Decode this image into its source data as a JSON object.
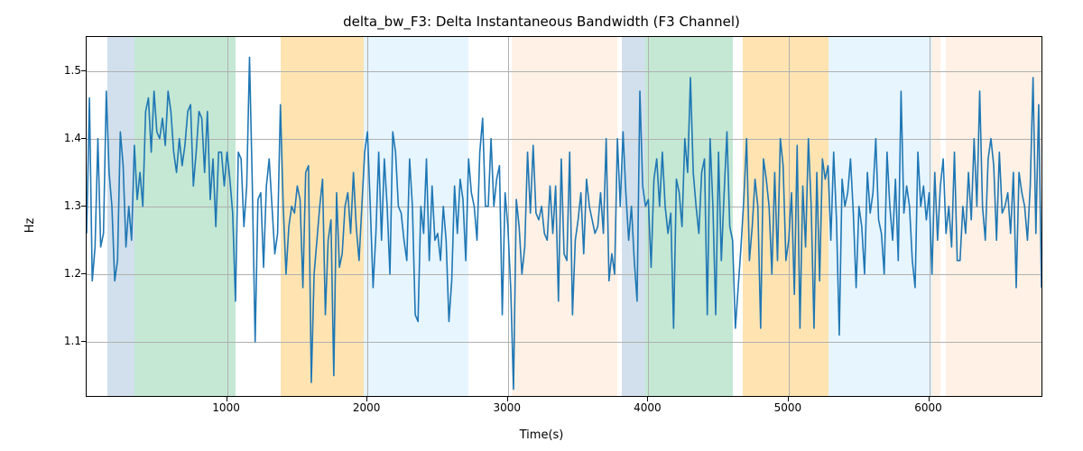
{
  "chart_data": {
    "type": "line",
    "title": "delta_bw_F3: Delta Instantaneous Bandwidth (F3 Channel)",
    "xlabel": "Time(s)",
    "ylabel": "Hz",
    "xlim": [
      0,
      6800
    ],
    "ylim": [
      1.02,
      1.55
    ],
    "xticks": [
      1000,
      2000,
      3000,
      4000,
      5000,
      6000
    ],
    "yticks": [
      1.1,
      1.2,
      1.3,
      1.4,
      1.5
    ],
    "bands": [
      {
        "x0": 150,
        "x1": 340,
        "color": "blue"
      },
      {
        "x0": 340,
        "x1": 1060,
        "color": "green"
      },
      {
        "x0": 1380,
        "x1": 1970,
        "color": "orange"
      },
      {
        "x0": 1970,
        "x1": 2720,
        "color": "lblue"
      },
      {
        "x0": 3030,
        "x1": 3780,
        "color": "peach"
      },
      {
        "x0": 3810,
        "x1": 3980,
        "color": "blue"
      },
      {
        "x0": 3980,
        "x1": 4600,
        "color": "green"
      },
      {
        "x0": 4670,
        "x1": 5280,
        "color": "orange"
      },
      {
        "x0": 5280,
        "x1": 6020,
        "color": "lblue"
      },
      {
        "x0": 6020,
        "x1": 6080,
        "color": "peach"
      },
      {
        "x0": 6120,
        "x1": 6800,
        "color": "peach"
      }
    ],
    "x": [
      0,
      20,
      40,
      60,
      80,
      100,
      120,
      140,
      160,
      180,
      200,
      220,
      240,
      260,
      280,
      300,
      320,
      340,
      360,
      380,
      400,
      420,
      440,
      460,
      480,
      500,
      520,
      540,
      560,
      580,
      600,
      620,
      640,
      660,
      680,
      700,
      720,
      740,
      760,
      780,
      800,
      820,
      840,
      860,
      880,
      900,
      920,
      940,
      960,
      980,
      1000,
      1020,
      1040,
      1060,
      1080,
      1100,
      1120,
      1140,
      1160,
      1180,
      1200,
      1220,
      1240,
      1260,
      1280,
      1300,
      1320,
      1340,
      1360,
      1380,
      1400,
      1420,
      1440,
      1460,
      1480,
      1500,
      1520,
      1540,
      1560,
      1580,
      1600,
      1620,
      1640,
      1660,
      1680,
      1700,
      1720,
      1740,
      1760,
      1780,
      1800,
      1820,
      1840,
      1860,
      1880,
      1900,
      1920,
      1940,
      1960,
      1980,
      2000,
      2020,
      2040,
      2060,
      2080,
      2100,
      2120,
      2140,
      2160,
      2180,
      2200,
      2220,
      2240,
      2260,
      2280,
      2300,
      2320,
      2340,
      2360,
      2380,
      2400,
      2420,
      2440,
      2460,
      2480,
      2500,
      2520,
      2540,
      2560,
      2580,
      2600,
      2620,
      2640,
      2660,
      2680,
      2700,
      2720,
      2740,
      2760,
      2780,
      2800,
      2820,
      2840,
      2860,
      2880,
      2900,
      2920,
      2940,
      2960,
      2980,
      3000,
      3020,
      3040,
      3060,
      3080,
      3100,
      3120,
      3140,
      3160,
      3180,
      3200,
      3220,
      3240,
      3260,
      3280,
      3300,
      3320,
      3340,
      3360,
      3380,
      3400,
      3420,
      3440,
      3460,
      3480,
      3500,
      3520,
      3540,
      3560,
      3580,
      3600,
      3620,
      3640,
      3660,
      3680,
      3700,
      3720,
      3740,
      3760,
      3780,
      3800,
      3820,
      3840,
      3860,
      3880,
      3900,
      3920,
      3940,
      3960,
      3980,
      4000,
      4020,
      4040,
      4060,
      4080,
      4100,
      4120,
      4140,
      4160,
      4180,
      4200,
      4220,
      4240,
      4260,
      4280,
      4300,
      4320,
      4340,
      4360,
      4380,
      4400,
      4420,
      4440,
      4460,
      4480,
      4500,
      4520,
      4540,
      4560,
      4580,
      4600,
      4620,
      4640,
      4660,
      4680,
      4700,
      4720,
      4740,
      4760,
      4780,
      4800,
      4820,
      4840,
      4860,
      4880,
      4900,
      4920,
      4940,
      4960,
      4980,
      5000,
      5020,
      5040,
      5060,
      5080,
      5100,
      5120,
      5140,
      5160,
      5180,
      5200,
      5220,
      5240,
      5260,
      5280,
      5300,
      5320,
      5340,
      5360,
      5380,
      5400,
      5420,
      5440,
      5460,
      5480,
      5500,
      5520,
      5540,
      5560,
      5580,
      5600,
      5620,
      5640,
      5660,
      5680,
      5700,
      5720,
      5740,
      5760,
      5780,
      5800,
      5820,
      5840,
      5860,
      5880,
      5900,
      5920,
      5940,
      5960,
      5980,
      6000,
      6020,
      6040,
      6060,
      6080,
      6100,
      6120,
      6140,
      6160,
      6180,
      6200,
      6220,
      6240,
      6260,
      6280,
      6300,
      6320,
      6340,
      6360,
      6380,
      6400,
      6420,
      6440,
      6460,
      6480,
      6500,
      6520,
      6540,
      6560,
      6580,
      6600,
      6620,
      6640,
      6660,
      6680,
      6700,
      6720,
      6740,
      6760,
      6780,
      6800
    ],
    "values": [
      1.26,
      1.46,
      1.19,
      1.24,
      1.4,
      1.24,
      1.26,
      1.47,
      1.35,
      1.3,
      1.19,
      1.22,
      1.41,
      1.36,
      1.24,
      1.3,
      1.25,
      1.39,
      1.31,
      1.35,
      1.3,
      1.44,
      1.46,
      1.38,
      1.47,
      1.41,
      1.4,
      1.43,
      1.39,
      1.47,
      1.44,
      1.38,
      1.35,
      1.4,
      1.36,
      1.39,
      1.44,
      1.45,
      1.33,
      1.38,
      1.44,
      1.43,
      1.35,
      1.44,
      1.31,
      1.37,
      1.27,
      1.38,
      1.38,
      1.33,
      1.38,
      1.34,
      1.29,
      1.16,
      1.38,
      1.37,
      1.27,
      1.33,
      1.52,
      1.33,
      1.1,
      1.31,
      1.32,
      1.21,
      1.33,
      1.37,
      1.3,
      1.23,
      1.26,
      1.45,
      1.3,
      1.2,
      1.27,
      1.3,
      1.29,
      1.33,
      1.31,
      1.18,
      1.35,
      1.36,
      1.04,
      1.2,
      1.25,
      1.3,
      1.34,
      1.14,
      1.25,
      1.28,
      1.05,
      1.32,
      1.21,
      1.23,
      1.3,
      1.32,
      1.26,
      1.35,
      1.27,
      1.22,
      1.3,
      1.38,
      1.41,
      1.3,
      1.18,
      1.26,
      1.38,
      1.25,
      1.37,
      1.3,
      1.2,
      1.41,
      1.38,
      1.3,
      1.29,
      1.25,
      1.22,
      1.37,
      1.3,
      1.14,
      1.13,
      1.3,
      1.26,
      1.37,
      1.22,
      1.33,
      1.25,
      1.26,
      1.22,
      1.3,
      1.25,
      1.13,
      1.19,
      1.33,
      1.26,
      1.34,
      1.31,
      1.22,
      1.37,
      1.32,
      1.3,
      1.25,
      1.38,
      1.43,
      1.3,
      1.3,
      1.4,
      1.3,
      1.34,
      1.36,
      1.14,
      1.32,
      1.27,
      1.18,
      1.03,
      1.31,
      1.27,
      1.2,
      1.24,
      1.38,
      1.29,
      1.39,
      1.29,
      1.28,
      1.3,
      1.26,
      1.25,
      1.33,
      1.26,
      1.33,
      1.16,
      1.37,
      1.23,
      1.22,
      1.38,
      1.14,
      1.25,
      1.28,
      1.32,
      1.23,
      1.34,
      1.3,
      1.28,
      1.26,
      1.27,
      1.32,
      1.26,
      1.4,
      1.19,
      1.23,
      1.2,
      1.4,
      1.3,
      1.41,
      1.32,
      1.25,
      1.3,
      1.22,
      1.16,
      1.47,
      1.33,
      1.3,
      1.31,
      1.21,
      1.34,
      1.37,
      1.3,
      1.38,
      1.3,
      1.26,
      1.29,
      1.12,
      1.34,
      1.32,
      1.27,
      1.4,
      1.35,
      1.49,
      1.35,
      1.3,
      1.26,
      1.35,
      1.37,
      1.14,
      1.4,
      1.3,
      1.14,
      1.38,
      1.22,
      1.32,
      1.41,
      1.27,
      1.25,
      1.12,
      1.18,
      1.24,
      1.31,
      1.4,
      1.22,
      1.27,
      1.34,
      1.3,
      1.12,
      1.37,
      1.34,
      1.3,
      1.2,
      1.35,
      1.22,
      1.4,
      1.36,
      1.22,
      1.25,
      1.32,
      1.17,
      1.39,
      1.12,
      1.33,
      1.24,
      1.4,
      1.3,
      1.12,
      1.35,
      1.19,
      1.37,
      1.34,
      1.36,
      1.25,
      1.38,
      1.28,
      1.11,
      1.34,
      1.3,
      1.32,
      1.37,
      1.29,
      1.18,
      1.3,
      1.27,
      1.2,
      1.35,
      1.29,
      1.32,
      1.4,
      1.28,
      1.26,
      1.2,
      1.38,
      1.3,
      1.25,
      1.34,
      1.22,
      1.47,
      1.29,
      1.33,
      1.3,
      1.22,
      1.18,
      1.38,
      1.3,
      1.33,
      1.28,
      1.32,
      1.2,
      1.35,
      1.25,
      1.33,
      1.37,
      1.26,
      1.3,
      1.24,
      1.38,
      1.22,
      1.22,
      1.3,
      1.26,
      1.35,
      1.28,
      1.4,
      1.3,
      1.47,
      1.3,
      1.25,
      1.37,
      1.4,
      1.36,
      1.25,
      1.38,
      1.29,
      1.3,
      1.32,
      1.26,
      1.35,
      1.18,
      1.35,
      1.32,
      1.3,
      1.25,
      1.33,
      1.49,
      1.26,
      1.45,
      1.18
    ]
  }
}
